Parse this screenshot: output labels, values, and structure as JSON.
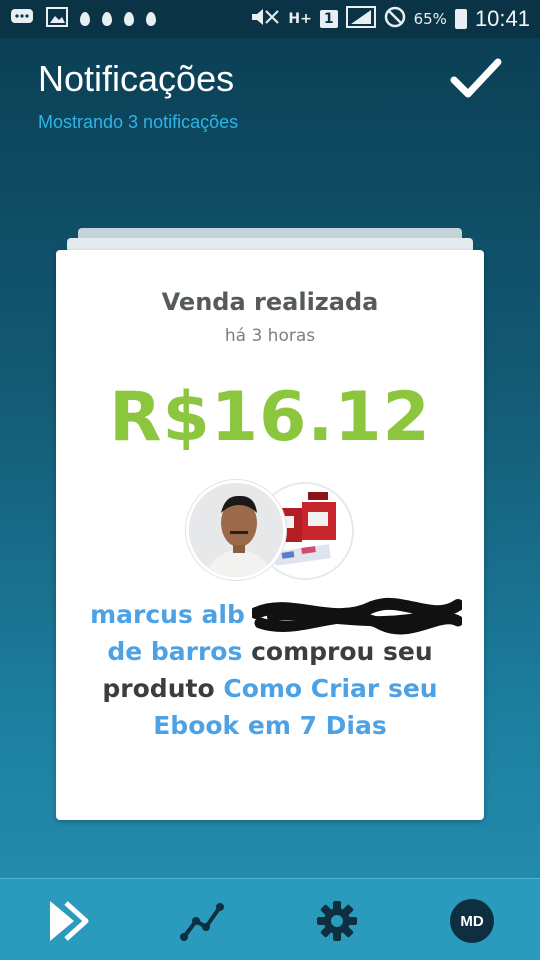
{
  "status_bar": {
    "network": "H+",
    "sim": "1",
    "battery_percent": "65%",
    "time": "10:41"
  },
  "header": {
    "title": "Notificações",
    "subtitle": "Mostrando 3 notificações",
    "confirm_icon": "check-icon"
  },
  "notification": {
    "title": "Venda realizada",
    "time_ago": "há 3 horas",
    "amount": "R$16.12",
    "buyer_name_visible_start": "marcus alb",
    "buyer_name_visible_end": "de barros",
    "action_text": "comprou seu produto",
    "product_name": "Como Criar seu Ebook em 7 Dias"
  },
  "bottom_nav": {
    "items": [
      {
        "icon": "forward-icon"
      },
      {
        "icon": "trend-chart-icon"
      },
      {
        "icon": "gear-icon"
      },
      {
        "label": "MD"
      }
    ]
  },
  "colors": {
    "amount": "#8cc63f",
    "link": "#4da2e6",
    "subtitle": "#2fb4ea",
    "nav_bg": "#2a9bbd"
  }
}
